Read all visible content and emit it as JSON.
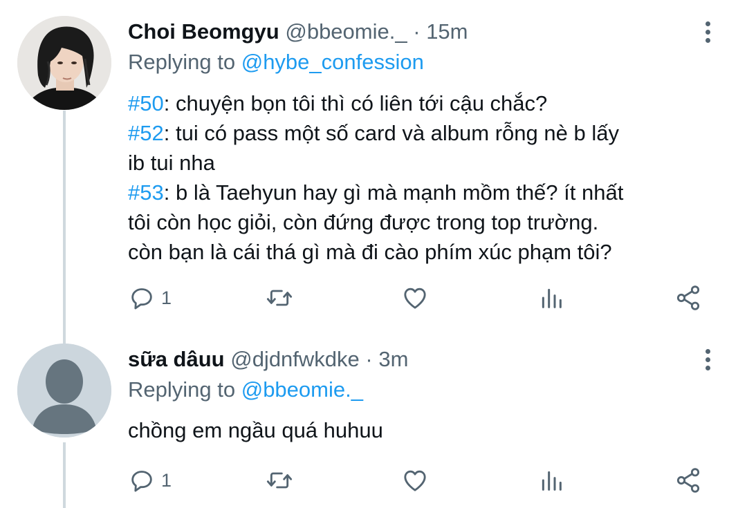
{
  "tweets": [
    {
      "name": "Choi Beomgyu",
      "handle": "@bbeomie._",
      "separator": "·",
      "time": "15m",
      "replying_prefix": "Replying to",
      "replying_to": "@hybe_confession",
      "lines": [
        {
          "tag": "#50",
          "text": ": chuyện bọn tôi thì có liên tới cậu chắc?"
        },
        {
          "tag": "#52",
          "text": ": tui có pass một số card và album rỗng nè b lấy"
        },
        {
          "tag": "",
          "text": "ib tui nha"
        },
        {
          "tag": "#53",
          "text": ": b là Taehyun hay gì mà mạnh mồm thế? ít nhất"
        },
        {
          "tag": "",
          "text": "tôi còn học giỏi, còn đứng được trong top trường."
        },
        {
          "tag": "",
          "text": "còn bạn là cái thá gì mà đi cào phím xúc phạm tôi?"
        }
      ],
      "reply_count": "1"
    },
    {
      "name": "sữa dâuu",
      "handle": "@djdnfwkdke",
      "separator": "·",
      "time": "3m",
      "replying_prefix": "Replying to",
      "replying_to": "@bbeomie._",
      "lines": [
        {
          "tag": "",
          "text": "chồng em ngầu quá huhuu"
        }
      ],
      "reply_count": "1"
    }
  ],
  "icons": {
    "reply": "reply-icon",
    "retweet": "retweet-icon",
    "like": "heart-icon",
    "analytics": "analytics-icon",
    "share": "share-icon",
    "more": "more-vertical-icon"
  },
  "colors": {
    "link": "#1d9bf0",
    "secondary_text": "#536471",
    "primary_text": "#0f1419",
    "thread_line": "#cfd9de",
    "default_avatar_bg": "#ccd6dd",
    "default_avatar_fg": "#66757f"
  }
}
